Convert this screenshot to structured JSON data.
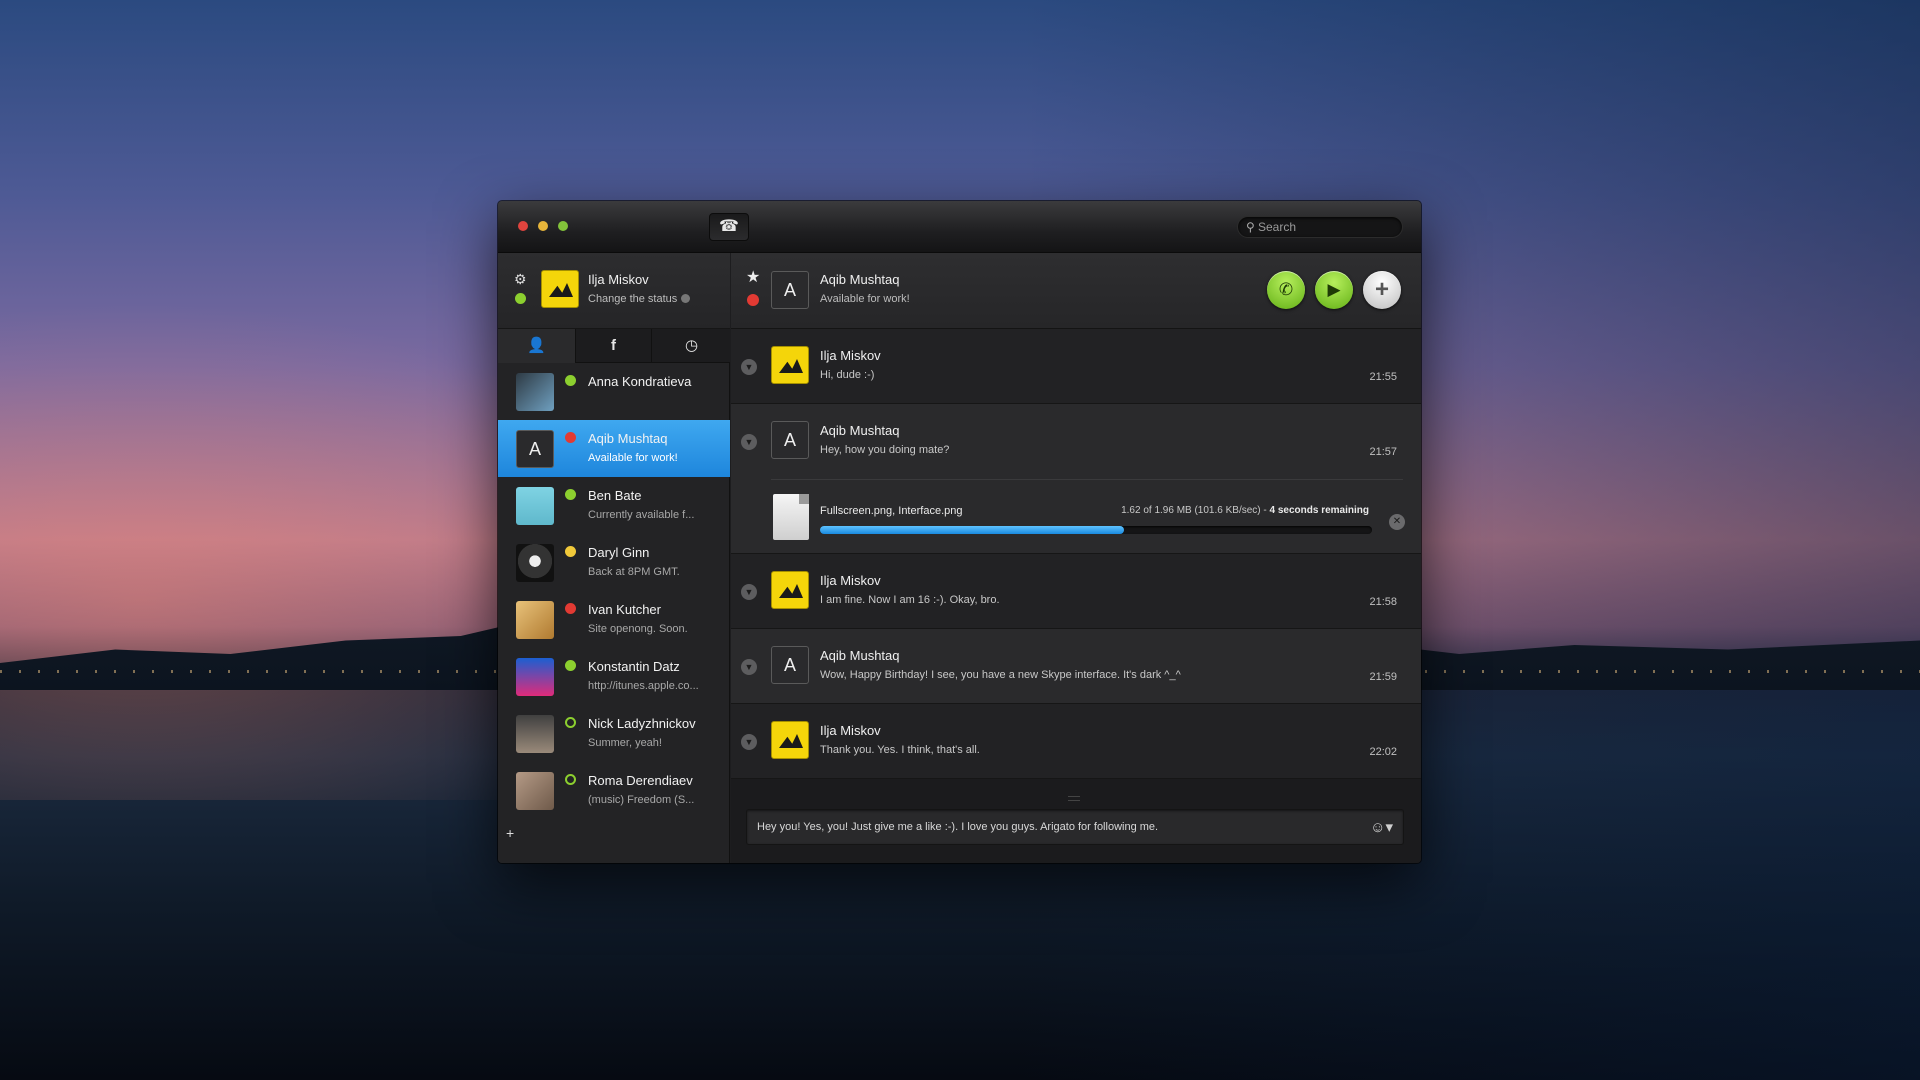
{
  "app": {
    "search_placeholder": "Search"
  },
  "me": {
    "name": "Ilja Miskov",
    "status_label": "Change the status"
  },
  "contacts": [
    {
      "name": "Anna Kondratieva",
      "status": ""
    },
    {
      "name": "Aqib Mushtaq",
      "status": "Available for work!"
    },
    {
      "name": "Ben Bate",
      "status": "Currently available f..."
    },
    {
      "name": "Daryl Ginn",
      "status": "Back at 8PM GMT."
    },
    {
      "name": "Ivan Kutcher",
      "status": "Site openong. Soon."
    },
    {
      "name": "Konstantin Datz",
      "status": "http://itunes.apple.co..."
    },
    {
      "name": "Nick Ladyzhnickov",
      "status": "Summer, yeah!"
    },
    {
      "name": "Roma Derendiaev",
      "status": "(music) Freedom (S..."
    }
  ],
  "chat": {
    "contact_initial": "A",
    "contact_name": "Aqib Mushtaq",
    "contact_status": "Available for work!",
    "messages": [
      {
        "author": "Ilja Miskov",
        "text": "Hi, dude :-)",
        "time": "21:55"
      },
      {
        "author": "Aqib Mushtaq",
        "text": "Hey, how you doing mate?",
        "time": "21:57"
      },
      {
        "author": "Ilja Miskov",
        "text": "I am fine. Now I am 16 :-). Okay, bro.",
        "time": "21:58"
      },
      {
        "author": "Aqib Mushtaq",
        "text": "Wow, Happy Birthday! I see, you have a new Skype interface. It's dark ^_^",
        "time": "21:59"
      },
      {
        "author": "Ilja Miskov",
        "text": "Thank you. Yes. I think, that's all.",
        "time": "22:02"
      }
    ],
    "transfer": {
      "files": "Fullscreen.png,  Interface.png",
      "progress_text": "1.62 of 1.96 MB (101.6 KB/sec) - ",
      "remaining": "4 seconds remaining",
      "progress_fraction": 0.55
    },
    "compose_value": "Hey you! Yes, you! Just give me a like :-). I love you guys. Arigato for following me."
  },
  "colors": {
    "accent_blue": "#1e86dc",
    "status_green": "#8ccf2f",
    "status_red": "#e23a33",
    "status_away": "#f1c93a",
    "avatar_yellow": "#f4d50a"
  },
  "icons": {
    "gear": "gear-icon",
    "phone": "phone-icon",
    "search": "search-icon",
    "contacts_tab": "person-icon",
    "facebook_tab": "facebook-icon",
    "history_tab": "clock-icon",
    "favorite": "star-icon",
    "call": "call-icon",
    "video": "video-icon",
    "add": "plus-icon",
    "emoji": "smiley-icon"
  }
}
